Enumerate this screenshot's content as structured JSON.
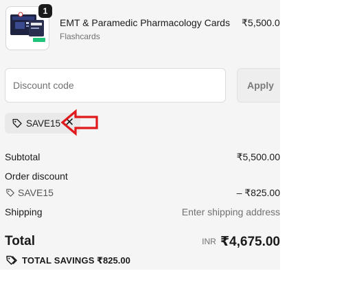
{
  "cart_item": {
    "image_icon": "product-box-image",
    "quantity": "1",
    "title": "EMT & Paramedic Pharmacology Cards",
    "subtitle": "Flashcards",
    "price": "₹5,500.00"
  },
  "discount": {
    "placeholder": "Discount code",
    "value": "",
    "apply_label": "Apply",
    "applied_code": "SAVE15",
    "tag_icon": "tag-icon",
    "remove_icon": "close-icon",
    "annotation": "red-arrow-pointer"
  },
  "summary": {
    "subtotal_label": "Subtotal",
    "subtotal_value": "₹5,500.00",
    "order_discount_label": "Order discount",
    "discount_code": "SAVE15",
    "discount_value": "– ₹825.00",
    "shipping_label": "Shipping",
    "shipping_value": "Enter shipping address",
    "total_label": "Total",
    "currency": "INR",
    "total_value": "₹4,675.00",
    "savings_label": "TOTAL SAVINGS",
    "savings_value": "₹825.00"
  },
  "colors": {
    "panel_bg": "#f5f5f5",
    "text": "#1a1a1a",
    "muted": "#707070",
    "arrow": "#e0191c",
    "promo_green": "#1fc47a"
  }
}
